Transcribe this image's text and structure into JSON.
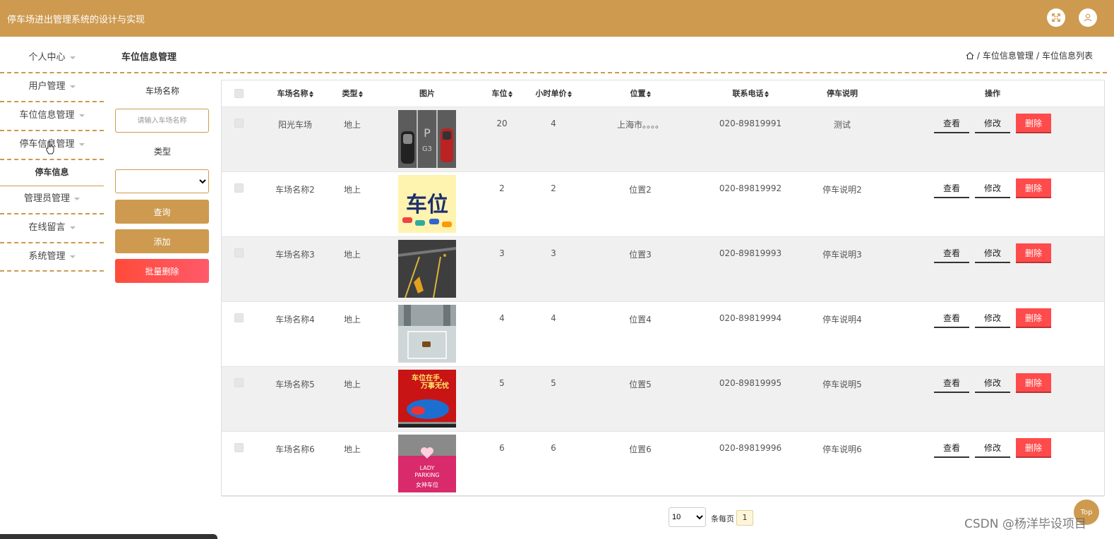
{
  "app": {
    "title": "停车场进出管理系统的设计与实现",
    "accent_color": "#CD9A4F",
    "fullscreen_icon": "fullscreen-icon",
    "user_icon": "user-icon"
  },
  "sidebar": {
    "items": [
      {
        "label": "个人中心"
      },
      {
        "label": "用户管理"
      },
      {
        "label": "车位信息管理"
      },
      {
        "label": "停车信息管理"
      },
      {
        "label": "停车信息",
        "submenu": true
      },
      {
        "label": "管理员管理"
      },
      {
        "label": "在线留言"
      },
      {
        "label": "系统管理"
      }
    ]
  },
  "header": {
    "page_title": "车位信息管理",
    "breadcrumb": [
      "车位信息管理",
      "车位信息列表"
    ],
    "breadcrumb_sep": "/"
  },
  "search": {
    "name_label": "车场名称",
    "name_placeholder": "请输入车场名称",
    "type_label": "类型",
    "type_value": "",
    "query_label": "查询",
    "add_label": "添加",
    "batch_delete_label": "批量删除"
  },
  "table": {
    "columns": [
      "车场名称",
      "类型",
      "图片",
      "车位",
      "小时单价",
      "位置",
      "联系电话",
      "停车说明",
      "操作"
    ],
    "actions": {
      "view": "查看",
      "edit": "修改",
      "delete": "删除"
    },
    "rows": [
      {
        "name": "阳光车场",
        "type": "地上",
        "image": "parking-lot-top-view",
        "spaces": "20",
        "price": "4",
        "location": "上海市。。。。",
        "phone": "020-89819991",
        "note": "测试"
      },
      {
        "name": "车场名称2",
        "type": "地上",
        "image": "parking-space-sign",
        "spaces": "2",
        "price": "2",
        "location": "位置2",
        "phone": "020-89819992",
        "note": "停车说明2"
      },
      {
        "name": "车场名称3",
        "type": "地上",
        "image": "parking-lock",
        "spaces": "3",
        "price": "3",
        "location": "位置3",
        "phone": "020-89819993",
        "note": "停车说明3"
      },
      {
        "name": "车场名称4",
        "type": "地上",
        "image": "underground-garage",
        "spaces": "4",
        "price": "4",
        "location": "位置4",
        "phone": "020-89819994",
        "note": "停车说明4"
      },
      {
        "name": "车场名称5",
        "type": "地上",
        "image": "parking-ad",
        "spaces": "5",
        "price": "5",
        "location": "位置5",
        "phone": "020-89819995",
        "note": "停车说明5"
      },
      {
        "name": "车场名称6",
        "type": "地上",
        "image": "lady-parking",
        "spaces": "6",
        "price": "6",
        "location": "位置6",
        "phone": "020-89819996",
        "note": "停车说明6"
      }
    ]
  },
  "images": {
    "row5_text_top": "车位在手,",
    "row5_text_bottom": "万事无忧",
    "row6_text_1": "LADY",
    "row6_text_2": "PARKING",
    "row6_text_3": "女神车位",
    "row2_text": "车位",
    "row1_text_1": "P",
    "row1_text_2": "G3"
  },
  "pagination": {
    "page_size": "10",
    "page_size_label": "条每页",
    "current_page": "1"
  },
  "back_to_top": "Top",
  "watermark": "CSDN @杨洋毕设项目"
}
